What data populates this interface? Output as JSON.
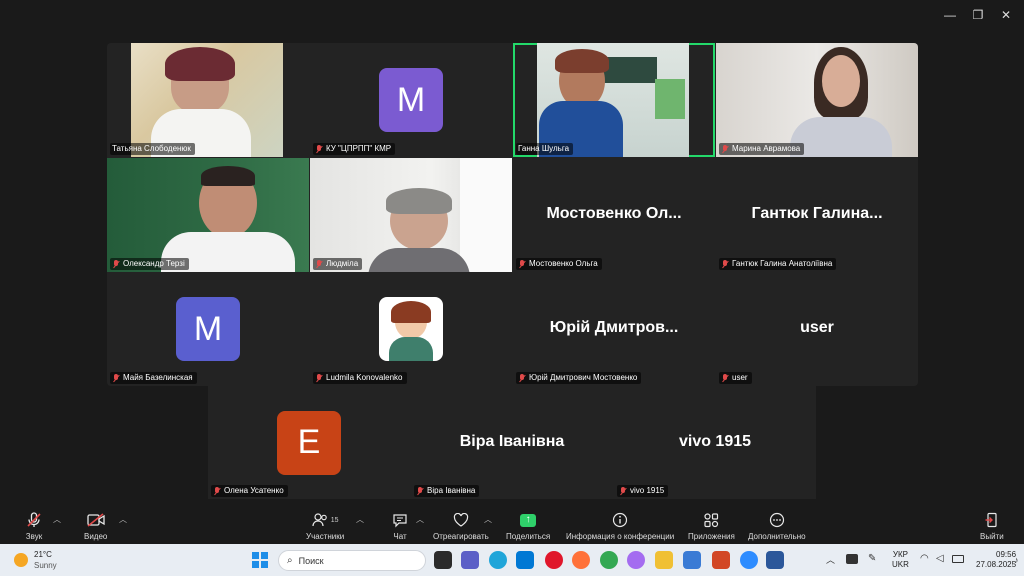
{
  "participants": [
    {
      "name": "Татьяна Слободенюк",
      "mic_muted": false,
      "type": "video"
    },
    {
      "name": "КУ \"ЦПРПП\" КМР",
      "mic_muted": true,
      "type": "avatar",
      "initial": "M",
      "color": "#7b5bd1"
    },
    {
      "name": "Ганна Шульга",
      "mic_muted": false,
      "type": "video",
      "active": true
    },
    {
      "name": "Марина Аврамова",
      "mic_muted": true,
      "type": "video"
    },
    {
      "name": "Олександр Терзі",
      "mic_muted": true,
      "type": "video"
    },
    {
      "name": "Людміла",
      "mic_muted": true,
      "type": "video"
    },
    {
      "name": "Мостовенко Ольга",
      "mic_muted": true,
      "type": "name",
      "display": "Мостовенко  Ол..."
    },
    {
      "name": "Гантюк Галина Анатоліївна",
      "mic_muted": true,
      "type": "name",
      "display": "Гантюк  Галина..."
    },
    {
      "name": "Майя Базелинская",
      "mic_muted": true,
      "type": "avatar",
      "initial": "M",
      "color": "#5a5fcf"
    },
    {
      "name": "Ludmila Konovalenko",
      "mic_muted": true,
      "type": "image"
    },
    {
      "name": "Юрій Дмитрович Мостовенко",
      "mic_muted": true,
      "type": "name",
      "display": "Юрій  Дмитров..."
    },
    {
      "name": "user",
      "mic_muted": true,
      "type": "name",
      "display": "user"
    },
    {
      "name": "Олена Усатенко",
      "mic_muted": true,
      "type": "avatar",
      "initial": "E",
      "color": "#c84316"
    },
    {
      "name": "Віра Іванівна",
      "mic_muted": true,
      "type": "name",
      "display": "Віра Іванівна"
    },
    {
      "name": "vivo 1915",
      "mic_muted": true,
      "type": "name",
      "display": "vivo 1915"
    }
  ],
  "toolbar": {
    "audio": "Звук",
    "video": "Видео",
    "participants": "Участники",
    "participants_count": "15",
    "chat": "Чат",
    "react": "Отреагировать",
    "share": "Поделиться",
    "info": "Информация о конференции",
    "apps": "Приложения",
    "more": "Дополнительно",
    "leave": "Выйти"
  },
  "taskbar": {
    "weather_temp": "21°C",
    "weather_desc": "Sunny",
    "search_placeholder": "Поиск",
    "lang1": "УКР",
    "lang2": "UKR",
    "time": "09:56",
    "date": "27.08.2025"
  }
}
